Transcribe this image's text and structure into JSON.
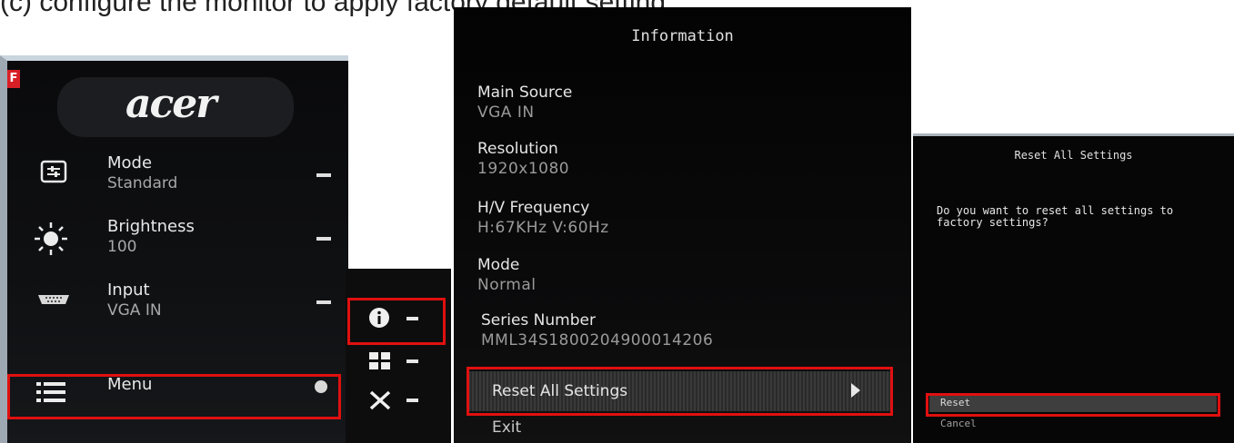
{
  "caption": "(c) configure the monitor to apply factory default setting",
  "main_menu": {
    "logo": "acer",
    "corner_badge": "F",
    "items": [
      {
        "label": "Mode",
        "value": "Standard",
        "icon": "mode-icon"
      },
      {
        "label": "Brightness",
        "value": "100",
        "icon": "sun-icon"
      },
      {
        "label": "Input",
        "value": "VGA IN",
        "icon": "vga-connector-icon"
      }
    ],
    "menu_label": "Menu"
  },
  "hotkeys": [
    "info-icon",
    "grid-icon",
    "close-icon"
  ],
  "information": {
    "title": "Information",
    "fields": [
      {
        "label": "Main Source",
        "value": "VGA IN"
      },
      {
        "label": "Resolution",
        "value": "1920x1080"
      },
      {
        "label": "H/V Frequency",
        "value": "H:67KHz V:60Hz"
      },
      {
        "label": "Mode",
        "value": "Normal"
      },
      {
        "label": "Series Number",
        "value": "MML34S1800204900014206"
      }
    ],
    "reset_label": "Reset All Settings",
    "exit_label": "Exit"
  },
  "reset_dialog": {
    "title": "Reset All Settings",
    "message": "Do you want to reset all settings to factory settings?",
    "reset_label": "Reset",
    "cancel_label": "Cancel"
  },
  "colors": {
    "highlight_box": "#e01010",
    "osd_background": "#0b0b0c"
  }
}
